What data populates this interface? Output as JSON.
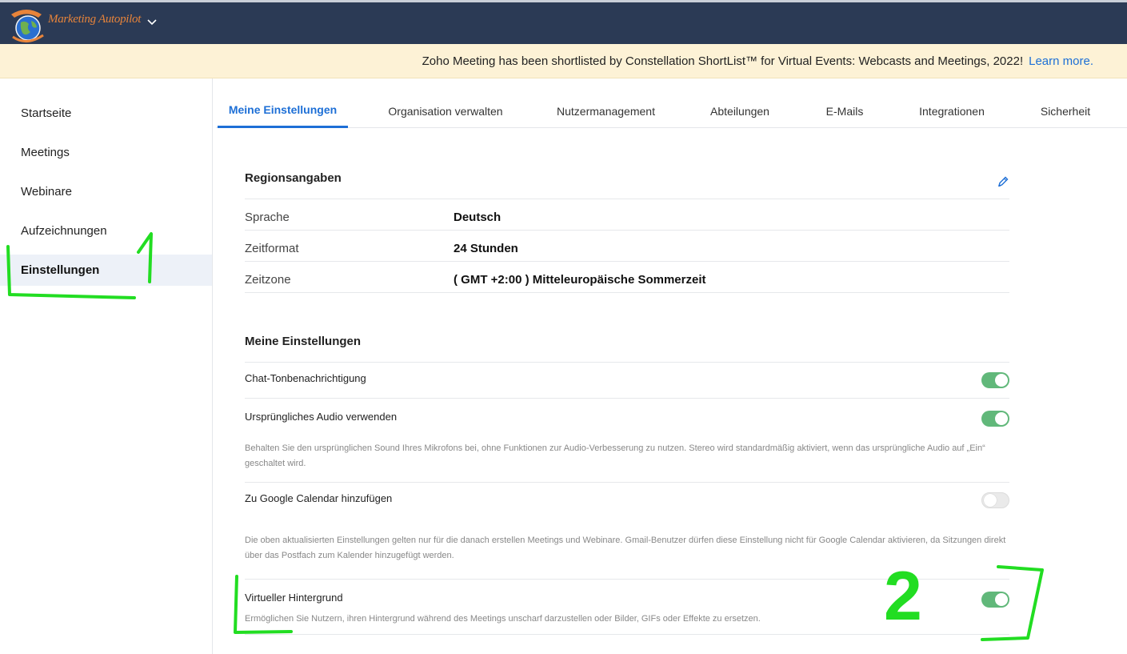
{
  "header": {
    "brand": "Marketing Autopilot",
    "logo_icon": "globe-logo-icon",
    "chevron_icon": "chevron-down-icon"
  },
  "banner": {
    "text": "Zoho Meeting has been shortlisted by Constellation ShortList™ for Virtual Events: Webcasts and Meetings, 2022!",
    "link": "Learn more."
  },
  "sidebar": {
    "items": [
      {
        "label": "Startseite"
      },
      {
        "label": "Meetings"
      },
      {
        "label": "Webinare"
      },
      {
        "label": "Aufzeichnungen"
      },
      {
        "label": "Einstellungen",
        "active": true
      }
    ]
  },
  "tabs": [
    {
      "label": "Meine Einstellungen",
      "active": true
    },
    {
      "label": "Organisation verwalten"
    },
    {
      "label": "Nutzermanagement"
    },
    {
      "label": "Abteilungen"
    },
    {
      "label": "E-Mails"
    },
    {
      "label": "Integrationen"
    },
    {
      "label": "Sicherheit"
    }
  ],
  "region": {
    "title": "Regionsangaben",
    "edit_icon": "pencil-icon",
    "rows": [
      {
        "label": "Sprache",
        "value": "Deutsch"
      },
      {
        "label": "Zeitformat",
        "value": "24 Stunden"
      },
      {
        "label": "Zeitzone",
        "value": "( GMT +2:00 ) Mitteleuropäische Sommerzeit"
      }
    ]
  },
  "settings": {
    "title": "Meine Einstellungen",
    "options": [
      {
        "label": "Chat-Tonbenachrichtigung",
        "enabled": true,
        "description": ""
      },
      {
        "label": "Ursprüngliches Audio verwenden",
        "enabled": true,
        "description": "Behalten Sie den ursprünglichen Sound Ihres Mikrofons bei, ohne Funktionen zur Audio-Verbesserung zu nutzen. Stereo wird standardmäßig aktiviert, wenn das ursprüngliche Audio auf „Ein“ geschaltet wird."
      },
      {
        "label": "Zu Google Calendar hinzufügen",
        "enabled": false,
        "description": "Die oben aktualisierten Einstellungen gelten nur für die danach erstellen Meetings und Webinare. Gmail-Benutzer dürfen diese Einstellung nicht für Google Calendar aktivieren, da Sitzungen direkt über das Postfach zum Kalender hinzugefügt werden."
      },
      {
        "label": "Virtueller Hintergrund",
        "enabled": true,
        "description": "Ermöglichen Sie Nutzern, ihren Hintergrund während des Meetings unscharf darzustellen oder Bilder, GIFs oder Effekte zu ersetzen."
      }
    ]
  },
  "annotations": {
    "marker_1": "1",
    "marker_2": "2",
    "color": "#22dd22"
  }
}
